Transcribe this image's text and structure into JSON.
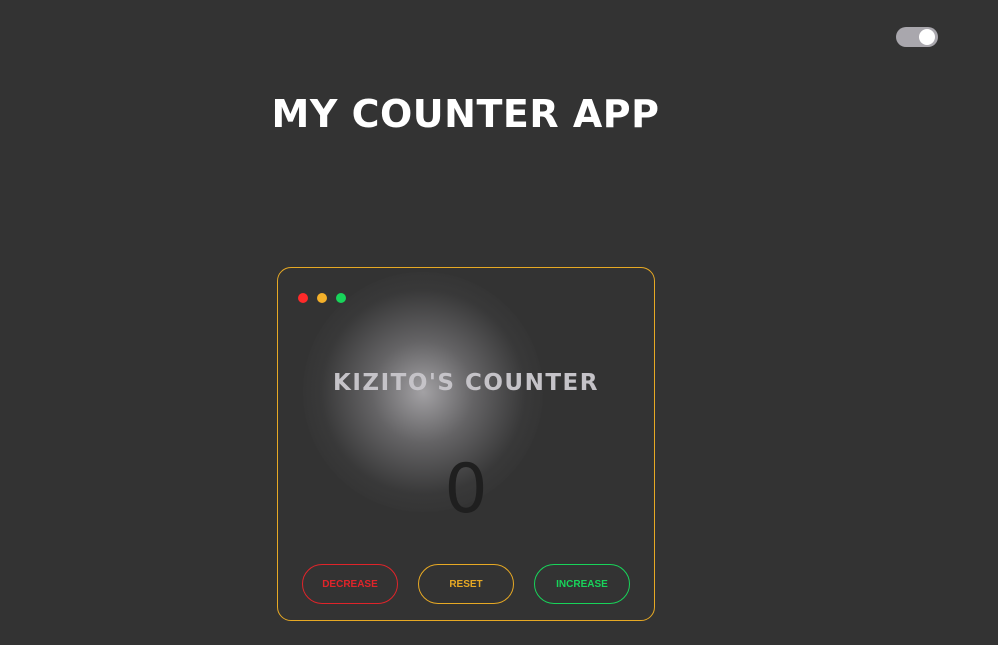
{
  "header": {
    "title": "MY COUNTER APP",
    "theme_toggle": {
      "icon": "toggle-switch-icon",
      "state": "on"
    }
  },
  "card": {
    "window_controls": [
      "red-dot-icon",
      "yellow-dot-icon",
      "green-dot-icon"
    ],
    "title": "KIZITO'S COUNTER",
    "value": "0",
    "buttons": {
      "decrease": "DECREASE",
      "reset": "RESET",
      "increase": "INCREASE"
    }
  },
  "colors": {
    "background": "#333333",
    "accent": "#e7a924",
    "decrease": "#e0242a",
    "increase": "#18d45a"
  }
}
